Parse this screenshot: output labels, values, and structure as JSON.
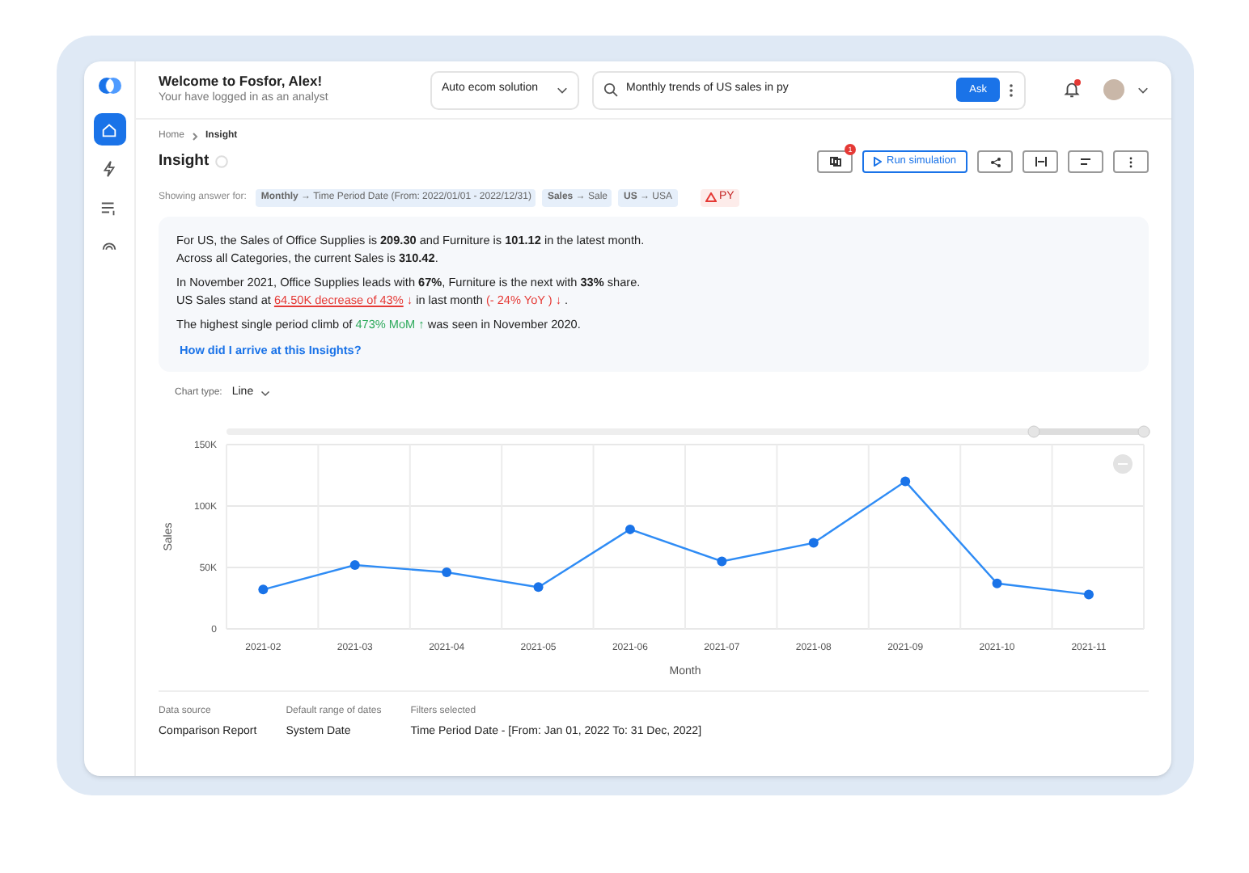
{
  "header": {
    "title": "Welcome to Fosfor, Alex!",
    "subtitle": "Your have logged in as an analyst",
    "solution": "Auto ecom solution",
    "query": "Monthly trends of US sales in py",
    "ask": "Ask",
    "notification_badge": true
  },
  "sidebar": {
    "items": [
      {
        "selected": true
      },
      {
        "selected": false
      },
      {
        "selected": false
      },
      {
        "selected": false
      }
    ]
  },
  "breadcrumb": [
    "Home",
    "Insight"
  ],
  "page_title": "Insight",
  "toolbar": {
    "badge": "1",
    "run": "Run simulation"
  },
  "filters": {
    "label": "Showing answer for:",
    "chips": [
      {
        "text": "**Monthly** → Time Period Date (From: 2022/01/01 - 2022/12/31)"
      },
      {
        "text": "**Sales** → Sale"
      },
      {
        "text": "**US** → USA"
      }
    ],
    "warning": "PY"
  },
  "insight": {
    "paragraphs": [
      [
        {
          "kind": "plain",
          "text": "For US, the Sales of Office Supplies is **209.30** and Furniture is **101.12** in the latest month."
        }
      ],
      [
        {
          "kind": "plain",
          "text": "Across all Categories, the current Sales is **310.42**."
        }
      ],
      [
        {
          "kind": "plain",
          "text": "In November 2021, Office Supplies leads with **67%**, Furniture is the next with **33%** share."
        }
      ],
      [
        {
          "kind": "plain",
          "text": "US Sales stand at "
        },
        {
          "kind": "negative-link",
          "text": "64.50K decrease of 43%"
        },
        {
          "kind": "negative",
          "text": " ↓"
        },
        {
          "kind": "plain",
          "text": " in last month "
        },
        {
          "kind": "negative",
          "text": "(- 24% YoY ) ↓"
        },
        {
          "kind": "plain",
          "text": " ."
        }
      ],
      [
        {
          "kind": "plain",
          "text": "The highest single period climb of "
        },
        {
          "kind": "positive",
          "text": "473% MoM ↑"
        },
        {
          "kind": "plain",
          "text": " was seen in November 2020."
        }
      ]
    ],
    "link": "How did I arrive at this Insights?"
  },
  "chart_type": {
    "label": "Chart type:",
    "value": "Line"
  },
  "chart_data": {
    "type": "line",
    "xlabel": "Month",
    "ylabel": "Sales",
    "categories": [
      "2021-02",
      "2021-03",
      "2021-04",
      "2021-05",
      "2021-06",
      "2021-07",
      "2021-08",
      "2021-09",
      "2021-10",
      "2021-11"
    ],
    "series": [
      {
        "color": "#2f8cf5",
        "marker": true,
        "values": [
          32000,
          52000,
          46000,
          34000,
          81000,
          55000,
          70000,
          120000,
          37000,
          28000
        ]
      }
    ],
    "ylim": [
      0,
      150000
    ],
    "yticks": [
      {
        "value": 0,
        "label": "0"
      },
      {
        "value": 50000,
        "label": "50K"
      },
      {
        "value": 100000,
        "label": "100K"
      },
      {
        "value": 150000,
        "label": "150K"
      }
    ]
  },
  "footer": [
    {
      "label": "Data source",
      "value": "Comparison Report"
    },
    {
      "label": "Default range of dates",
      "value": "System Date"
    },
    {
      "label": "Filters selected",
      "value": "Time Period Date - [From: Jan 01, 2022 To: 31 Dec, 2022]"
    }
  ]
}
